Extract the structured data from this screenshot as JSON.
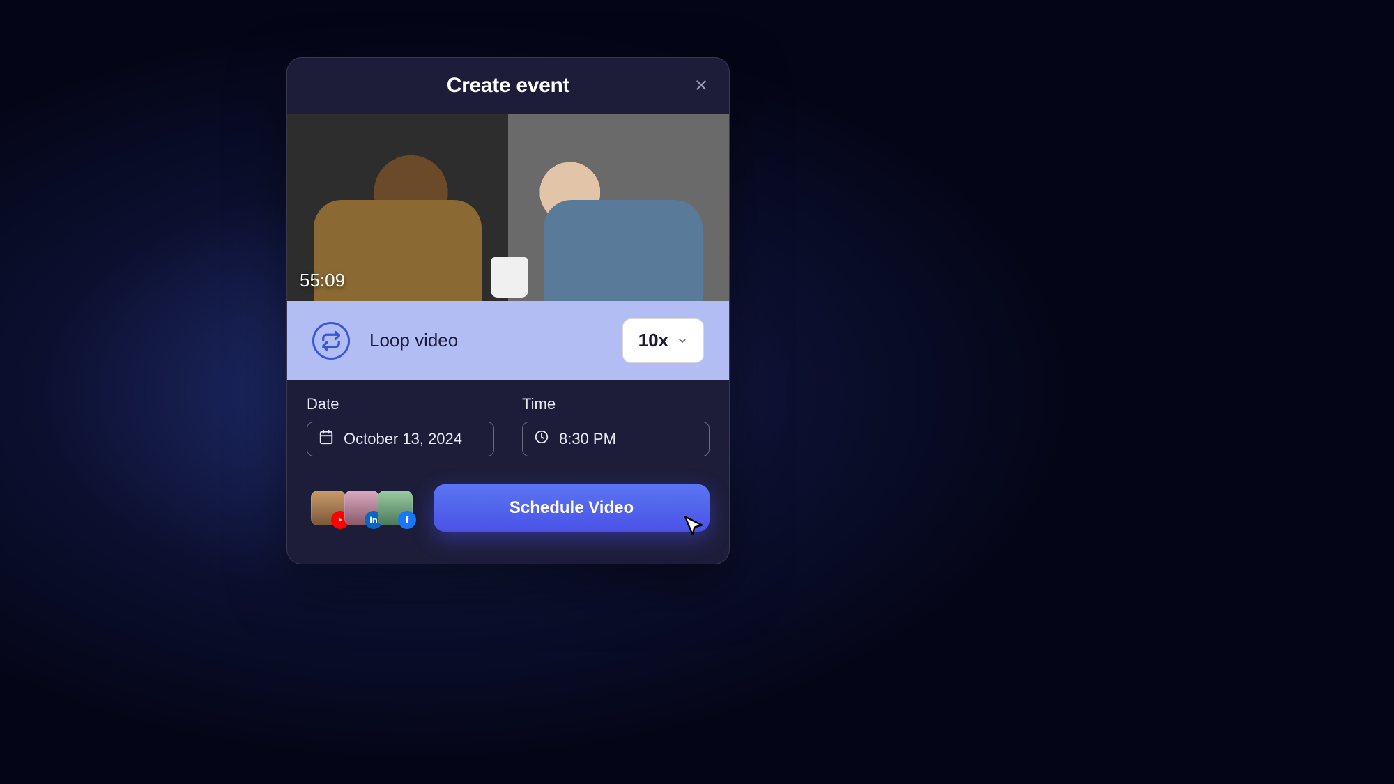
{
  "modal": {
    "title": "Create event",
    "video_duration": "55:09"
  },
  "loop": {
    "label": "Loop video",
    "selected": "10x"
  },
  "date": {
    "label": "Date",
    "value": "October 13, 2024"
  },
  "time": {
    "label": "Time",
    "value": "8:30 PM"
  },
  "platforms": [
    "youtube",
    "linkedin",
    "facebook"
  ],
  "cta": "Schedule Video"
}
